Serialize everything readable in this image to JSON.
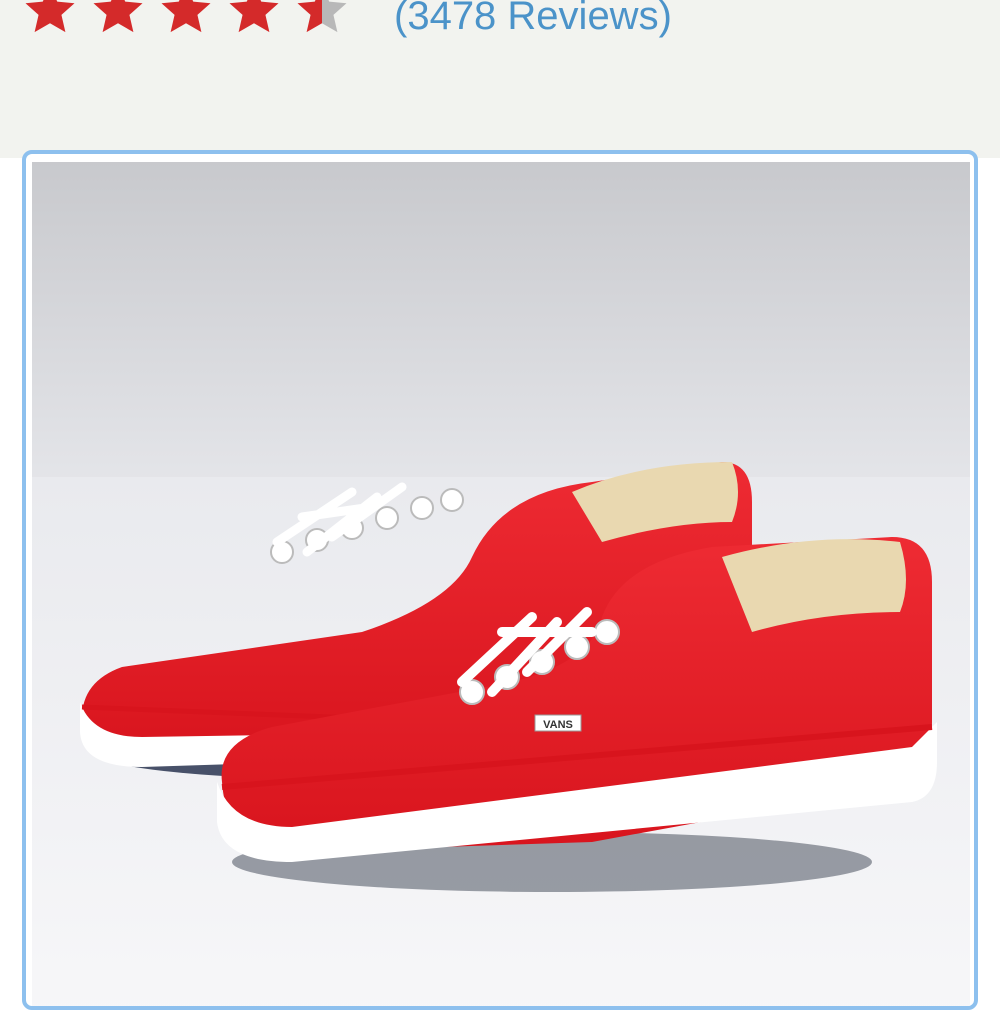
{
  "rating": {
    "value": 4.5,
    "max": 5,
    "reviews_label": "(3478 Reviews)",
    "filled_color": "#d42a2a",
    "empty_color": "#b8b8b8"
  },
  "product_image": {
    "brand_label": "VANS",
    "icon": "red-sneakers-photo"
  },
  "colors": {
    "header_bg": "#f2f3ef",
    "frame_border": "#8dc0ee",
    "link": "#4b93c9"
  }
}
